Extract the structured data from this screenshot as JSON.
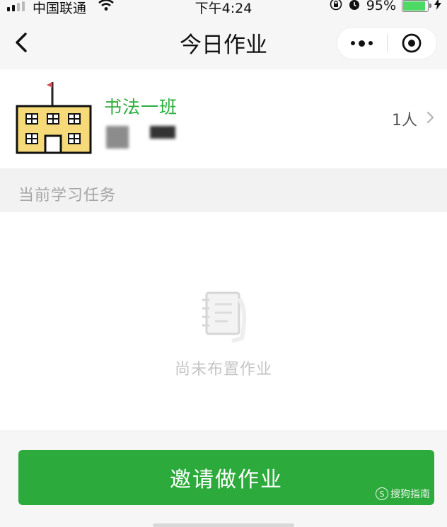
{
  "status_bar": {
    "carrier": "中国联通",
    "time": "下午4:24",
    "battery_percent": "95%",
    "battery_level": 0.95,
    "icons": [
      "signal-icon",
      "wifi-icon",
      "screen-lock-icon",
      "alarm-icon",
      "battery-icon",
      "charging-icon"
    ]
  },
  "nav": {
    "title": "今日作业",
    "icons": [
      "back-chevron-icon",
      "more-dots-icon",
      "close-target-icon"
    ]
  },
  "class_info": {
    "name": "书法一班",
    "member_count": "1人",
    "icon": "school-building-icon"
  },
  "section": {
    "title": "当前学习任务"
  },
  "empty_state": {
    "text": "尚未布置作业",
    "icon": "notebook-icon"
  },
  "actions": {
    "invite_label": "邀请做作业"
  },
  "watermark": {
    "text": "搜狗指南",
    "logo": "S"
  },
  "colors": {
    "accent_green": "#2daa3c",
    "class_name_green": "#2aae3e",
    "background": "#f2f2f2"
  }
}
